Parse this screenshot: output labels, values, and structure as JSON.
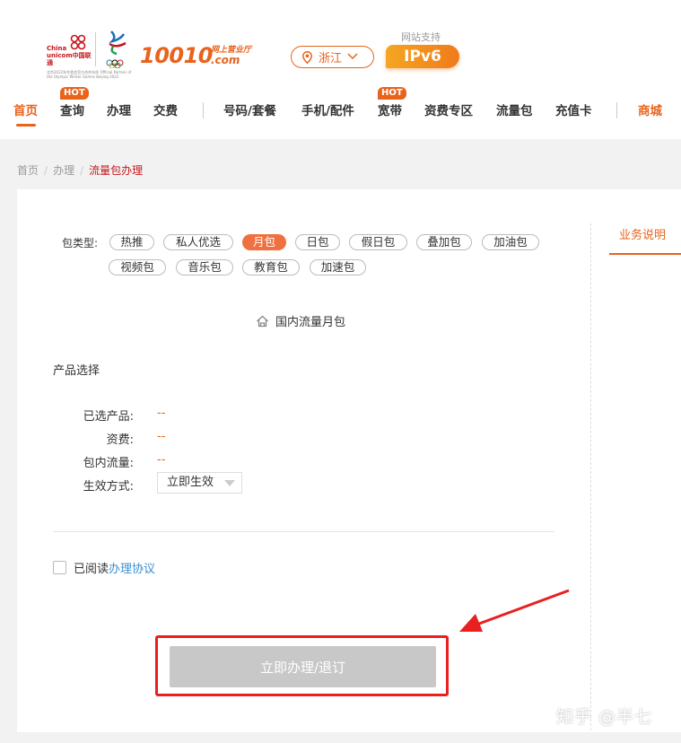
{
  "header": {
    "brand_cn": "China unicom中国联通",
    "partner_text": "北京2022年冬奥会官方合作伙伴 Official Partner of the Olympic Winter Games Beijing 2022",
    "olympic_text": "BEIJING 2022",
    "logo_number": "10010",
    "logo_sub": "网上营业厅",
    "logo_com": ".com",
    "region": "浙江",
    "ipv6_label": "网站支持",
    "ipv6_badge": "IPv6"
  },
  "nav": {
    "items": [
      {
        "label": "首页"
      },
      {
        "label": "查询",
        "hot": "HOT"
      },
      {
        "label": "办理"
      },
      {
        "label": "交费"
      },
      {
        "label": "号码/套餐"
      },
      {
        "label": "手机/配件"
      },
      {
        "label": "宽带",
        "hot": "HOT"
      },
      {
        "label": "资费专区"
      },
      {
        "label": "流量包"
      },
      {
        "label": "充值卡"
      },
      {
        "label": "商城"
      }
    ]
  },
  "breadcrumb": {
    "home": "首页",
    "level2": "办理",
    "current": "流量包办理",
    "sep": "/"
  },
  "side": {
    "tab": "业务说明"
  },
  "package": {
    "label": "包类型:",
    "types": [
      "热推",
      "私人优选",
      "月包",
      "日包",
      "假日包",
      "叠加包",
      "加油包",
      "视频包",
      "音乐包",
      "教育包",
      "加速包"
    ],
    "selected": "月包"
  },
  "section": {
    "title": "国内流量月包"
  },
  "product": {
    "heading": "产品选择",
    "selected_label": "已选产品:",
    "selected_value": "--",
    "fee_label": "资费:",
    "fee_value": "--",
    "traffic_label": "包内流量:",
    "traffic_value": "--",
    "effect_label": "生效方式:",
    "effect_value": "立即生效"
  },
  "agreement": {
    "prefix": "已阅读",
    "link": "办理协议"
  },
  "submit": {
    "label": "立即办理/退订"
  },
  "watermark": "知乎 @半七",
  "colors": {
    "accent": "#e8631c",
    "selected_tag": "#f07040",
    "highlight_frame": "#e8201f",
    "link": "#3a8fd6",
    "disabled_button": "#c8c8c8"
  }
}
